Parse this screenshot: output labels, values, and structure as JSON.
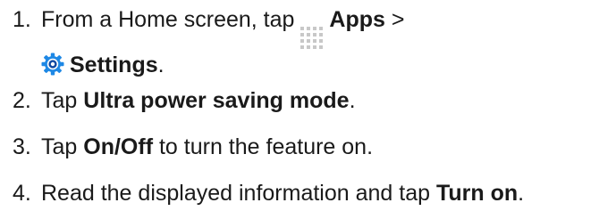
{
  "steps": [
    {
      "number": "1.",
      "line1_prefix": "From a Home screen, tap",
      "apps_label": "Apps",
      "separator": ">",
      "settings_label": "Settings",
      "line2_suffix": "."
    },
    {
      "number": "2.",
      "prefix": "Tap",
      "bold": "Ultra power saving mode",
      "suffix": "."
    },
    {
      "number": "3.",
      "prefix": "Tap",
      "bold": "On/Off",
      "suffix": "to turn the feature on."
    },
    {
      "number": "4.",
      "prefix": "Read the displayed information and tap",
      "bold": "Turn on",
      "suffix": "."
    }
  ],
  "icons": {
    "apps": "apps-grid-icon",
    "settings": "settings-gear-icon"
  },
  "colors": {
    "text": "#1a1a1a",
    "apps_icon": "#c8c8c8",
    "settings_icon_outer": "#1e88e5",
    "settings_icon_inner": "#0d47a1"
  }
}
